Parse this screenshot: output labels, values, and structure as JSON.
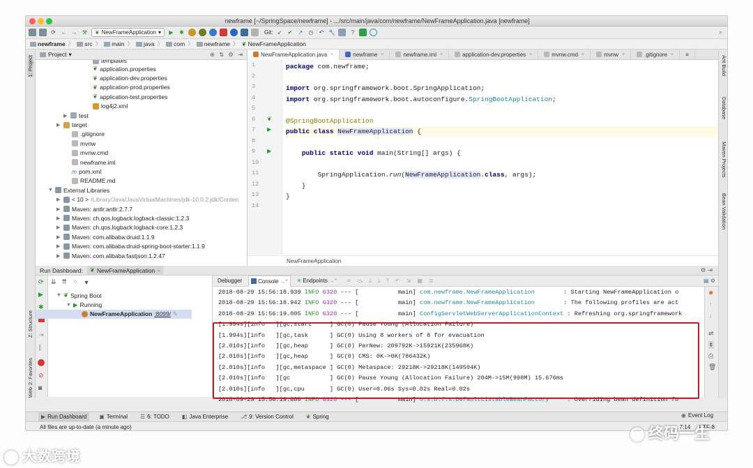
{
  "window": {
    "title": "newframe [~/SpringSpace/newframe] - .../src/main/java/com/newframe/NewFrameApplication.java [newframe]"
  },
  "toolbar": {
    "run_config": "NewFrameApplication",
    "git_label": "Git:"
  },
  "breadcrumb": [
    "newframe",
    "src",
    "main",
    "java",
    "com",
    "newframe",
    "NewFrameApplication"
  ],
  "left_strip": {
    "project_tab": "1: Project",
    "structure_tab": "Z: Structure",
    "favorites_tab": "2: Favorites",
    "web_tab": "Web"
  },
  "right_strip": {
    "ant_build": "Ant Build",
    "database": "Database",
    "maven_projects": "Maven Projects",
    "bean_validation": "Bean Validation"
  },
  "project": {
    "header": "Project",
    "items": [
      {
        "label": "templates",
        "indent": 72,
        "icon": "folder"
      },
      {
        "label": "application.properties",
        "indent": 72,
        "icon": "leaf"
      },
      {
        "label": "application-dev.properties",
        "indent": 72,
        "icon": "leaf"
      },
      {
        "label": "application-prod.properties",
        "indent": 72,
        "icon": "leaf"
      },
      {
        "label": "application-test.properties",
        "indent": 72,
        "icon": "leaf"
      },
      {
        "label": "log4j2.xml",
        "indent": 72,
        "icon": "xml"
      },
      {
        "label": "test",
        "indent": 64,
        "icon": "folder",
        "arrow": "▶"
      },
      {
        "label": "target",
        "indent": 52,
        "icon": "folder-orange",
        "arrow": "▶"
      },
      {
        "label": ".gitignore",
        "indent": 64,
        "icon": "file"
      },
      {
        "label": "mvnw",
        "indent": 64,
        "icon": "file"
      },
      {
        "label": "mvnw.cmd",
        "indent": 64,
        "icon": "file"
      },
      {
        "label": "newframe.iml",
        "indent": 64,
        "icon": "file"
      },
      {
        "label": "pom.xml",
        "indent": 64,
        "icon": "maven"
      },
      {
        "label": "README.md",
        "indent": 64,
        "icon": "file"
      },
      {
        "label": "External Libraries",
        "indent": 40,
        "icon": "lib",
        "arrow": "▼"
      },
      {
        "label": "< 10 >",
        "suffix": "/Library/Java/JavaVirtualMachines/jdk-10.0.2.jdk/Conten",
        "indent": 52,
        "icon": "lib",
        "arrow": "▶"
      },
      {
        "label": "Maven: antlr:antlr:2.7.7",
        "indent": 52,
        "icon": "lib",
        "arrow": "▶"
      },
      {
        "label": "Maven: ch.qos.logback:logback-classic:1.2.3",
        "indent": 52,
        "icon": "lib",
        "arrow": "▶"
      },
      {
        "label": "Maven: ch.qos.logback:logback-core:1.2.3",
        "indent": 52,
        "icon": "lib",
        "arrow": "▶"
      },
      {
        "label": "Maven: com.alibaba:druid:1.1.9",
        "indent": 52,
        "icon": "lib",
        "arrow": "▶"
      },
      {
        "label": "Maven: com.alibaba:druid-spring-boot-starter:1.1.9",
        "indent": 52,
        "icon": "lib",
        "arrow": "▶"
      },
      {
        "label": "Maven: com.alibaba:fastjson:1.2.47",
        "indent": 52,
        "icon": "lib",
        "arrow": "▶"
      }
    ]
  },
  "editor": {
    "tabs": [
      {
        "label": "NewFrameApplication.java",
        "active": true
      },
      {
        "label": "newframe"
      },
      {
        "label": "newframe.iml"
      },
      {
        "label": "application-dev.properties"
      },
      {
        "label": "mvnw.cmd"
      },
      {
        "label": "mvnw"
      },
      {
        "label": ".gitignore"
      }
    ],
    "line_numbers": [
      "1",
      "2",
      "3",
      "4",
      "5",
      "6",
      "7",
      "8",
      "9",
      "10",
      "11",
      "12",
      "13",
      "14"
    ],
    "footer": "NewFrameApplication"
  },
  "run_dashboard": {
    "title": "Run Dashboard:",
    "config": "NewFrameApplication",
    "tree": [
      {
        "label": "Spring Boot"
      },
      {
        "label": "Running"
      },
      {
        "label": "NewFrameApplication",
        "port": ":8099/"
      }
    ]
  },
  "console": {
    "tabs": [
      "Debugger",
      "Console",
      "Endpoints"
    ],
    "lines": [
      {
        "ts": "2018-08-29 15:56:18.939",
        "level": "INFO",
        "pid": "6320",
        "dash": "---",
        "thread": "[           main]",
        "logger": "com.newframe.NewFrameApplication        ",
        "msg": ": Starting NewFrameApplication o"
      },
      {
        "ts": "2018-08-29 15:56:18.942",
        "level": "INFO",
        "pid": "6320",
        "dash": "---",
        "thread": "[           main]",
        "logger": "com.newframe.NewFrameApplication        ",
        "msg": ": The following profiles are act"
      },
      {
        "ts": "2018-08-29 15:56:19.005",
        "level": "INFO",
        "pid": "6320",
        "dash": "---",
        "thread": "[           main]",
        "logger": "ConfigServletWebServerApplicationContext",
        "msg": " : Refreshing org.springframework"
      }
    ],
    "gc_lines": [
      "[1.994s][info   ][gc,start     ] GC(0) Pause Young (Allocation Failure)",
      "[1.994s][info   ][gc,task      ] GC(0) Using 8 workers of 8 for evacuation",
      "[2.010s][info   ][gc,heap      ] GC(0) ParNew: 209792K->15921K(235968K)",
      "[2.010s][info   ][gc,heap      ] GC(0) CMS: 0K->0K(786432K)",
      "[2.010s][info   ][gc,metaspace ] GC(0) Metaspace: 29218K->29218K(149504K)",
      "[2.010s][info   ][gc           ] GC(0) Pause Young (Allocation Failure) 204M->15M(998M) 15.676ms",
      "[2.010s][info   ][gc,cpu       ] GC(0) User=0.06s Sys=0.02s Real=0.02s"
    ],
    "last_line": {
      "ts": "2018-09-29 15:56:19.680",
      "level": "INFO",
      "pid": "6320",
      "dash": "---",
      "thread": "[           main]",
      "logger": "o.s.b.f.s.DefaultListableBeanFactory    ",
      "msg": " : Overriding bean definition fo"
    }
  },
  "bottom_tabs": [
    {
      "label": "Run Dashboard",
      "active": true
    },
    {
      "label": "Terminal"
    },
    {
      "label": "6: TODO"
    },
    {
      "label": "Java Enterprise"
    },
    {
      "label": "9: Version Control"
    },
    {
      "label": "Spring"
    }
  ],
  "event_log": "Event Log",
  "status": {
    "message": "All files are up-to-date (a minute ago)",
    "position": "7:14",
    "encoding": "UTF-8"
  },
  "watermarks": {
    "left": "大数跨境",
    "right": "终码一生"
  }
}
